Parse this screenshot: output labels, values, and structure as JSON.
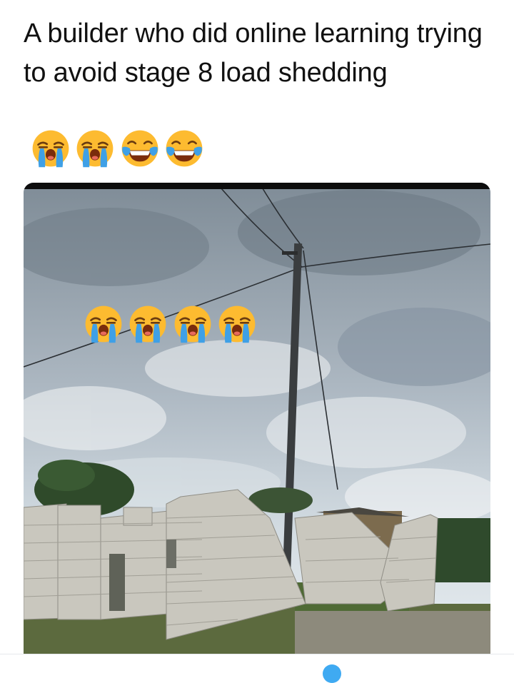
{
  "post": {
    "text": "A builder who did online learning trying to avoid stage 8 load shedding",
    "caption_emojis": [
      "loudly-crying-face",
      "loudly-crying-face",
      "tears-of-joy-face",
      "tears-of-joy-face"
    ]
  },
  "image": {
    "overlay_emojis": [
      "loudly-crying-face",
      "loudly-crying-face",
      "loudly-crying-face",
      "loudly-crying-face"
    ]
  },
  "colors": {
    "text": "#111111",
    "emoji_yellow": "#fdbb30",
    "tear_blue": "#3fa0e6",
    "sky": "#b8c3cd",
    "blocks": "#c9c7be",
    "accent": "#1d9bf0"
  }
}
